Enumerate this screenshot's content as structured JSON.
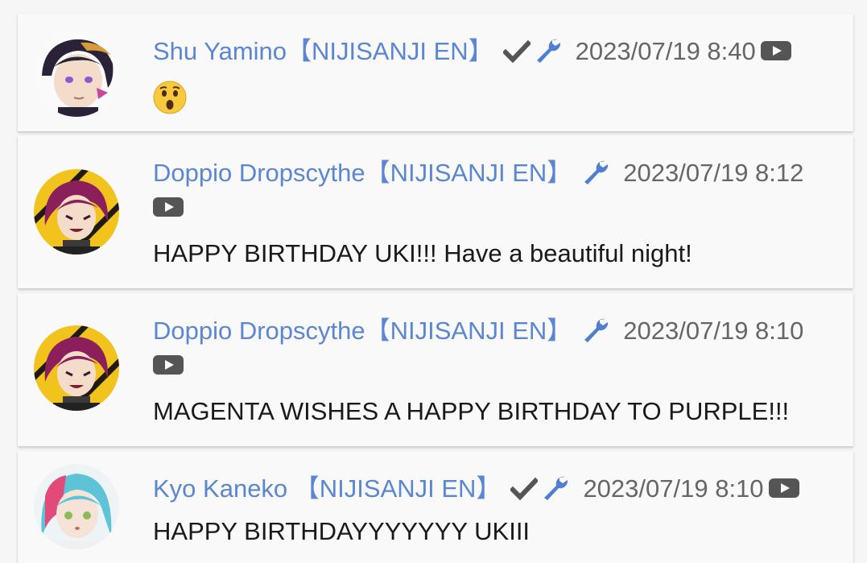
{
  "comments": [
    {
      "author": "Shu Yamino【NIJISANJI EN】",
      "verified": true,
      "moderator": true,
      "timestamp": "2023/07/19 8:40",
      "message": "",
      "emoji": "astonished-face",
      "avatar": "shu-yamino"
    },
    {
      "author": "Doppio Dropscythe【NIJISANJI EN】",
      "verified": false,
      "moderator": true,
      "timestamp": "2023/07/19 8:12",
      "message": "HAPPY BIRTHDAY UKI!!! Have a beautiful night!",
      "avatar": "doppio-dropscythe"
    },
    {
      "author": "Doppio Dropscythe【NIJISANJI EN】",
      "verified": false,
      "moderator": true,
      "timestamp": "2023/07/19 8:10",
      "message": "MAGENTA WISHES A HAPPY BIRTHDAY TO PURPLE!!!",
      "avatar": "doppio-dropscythe"
    },
    {
      "author": "Kyo Kaneko 【NIJISANJI EN】",
      "verified": true,
      "moderator": true,
      "timestamp": "2023/07/19 8:10",
      "message": "HAPPY BIRTHDAYYYYYYY UKIII",
      "avatar": "kyo-kaneko"
    }
  ],
  "colors": {
    "author": "#5b86d2",
    "timestamp": "#666666",
    "icon_gray": "#555555",
    "wrench": "#4f7fd0",
    "card_bg": "#f9f9f9",
    "page_bg": "#f6f6f6"
  },
  "icons": {
    "verified": "check-icon",
    "moderator": "wrench-icon",
    "source": "youtube-icon"
  }
}
